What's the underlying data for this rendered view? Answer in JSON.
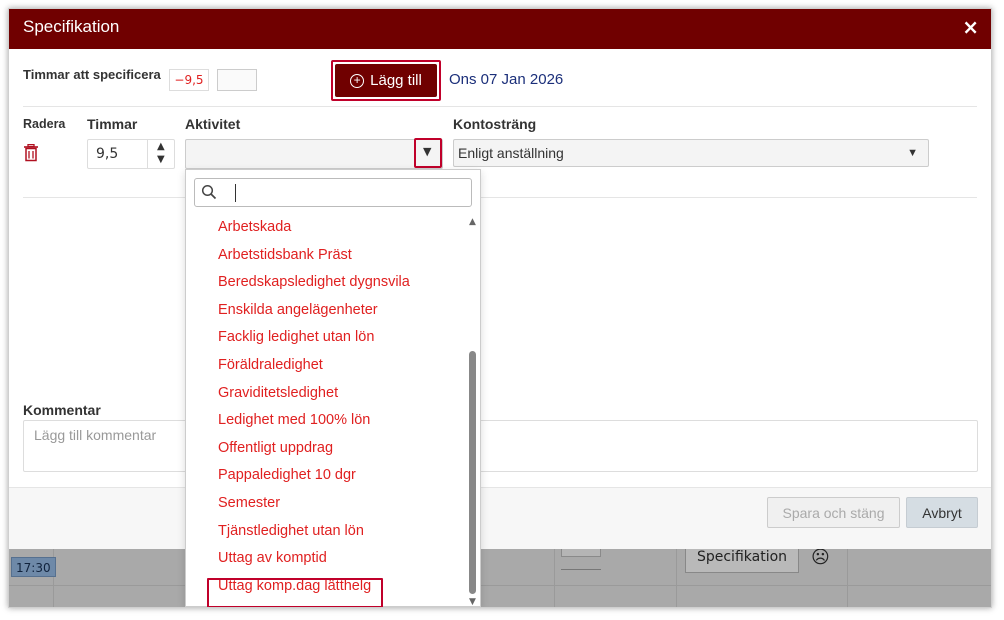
{
  "dialog": {
    "title": "Specifikation",
    "close_label": "×"
  },
  "hours_to_specify": {
    "label": "Timmar att specificera",
    "value": "−9,5"
  },
  "add_button": {
    "label": "Lägg till",
    "icon": "plus-circle-icon"
  },
  "date": "Ons 07 Jan 2026",
  "columns": {
    "delete": "Radera",
    "hours": "Timmar",
    "activity": "Aktivitet",
    "account": "Kontosträng"
  },
  "row": {
    "hours_value": "9,5",
    "activity_value": "",
    "account_value": "Enligt anställning"
  },
  "activity_dropdown": {
    "search_value": "",
    "items": [
      "Arbetskada",
      "Arbetstidsbank Präst",
      "Beredskapsledighet dygnsvila",
      "Enskilda angelägenheter",
      "Facklig ledighet utan lön",
      "Föräldraledighet",
      "Graviditetsledighet",
      "Ledighet med 100% lön",
      "Offentligt uppdrag",
      "Pappaledighet 10 dgr",
      "Semester",
      "Tjänstledighet utan lön",
      "Uttag av komptid",
      "Uttag komp.dag lätthelg"
    ],
    "highlighted_item": "Uttag komp.dag lätthelg",
    "item_color": "#e02020"
  },
  "comment": {
    "label": "Kommentar",
    "placeholder": "Lägg till kommentar"
  },
  "footer": {
    "save_label": "Spara och stäng",
    "cancel_label": "Avbryt"
  },
  "background": {
    "time": "17:30",
    "specification_button": "Specifikation"
  },
  "colors": {
    "header": "#700000",
    "highlight": "#c0002a",
    "date": "#1b2f7a"
  }
}
